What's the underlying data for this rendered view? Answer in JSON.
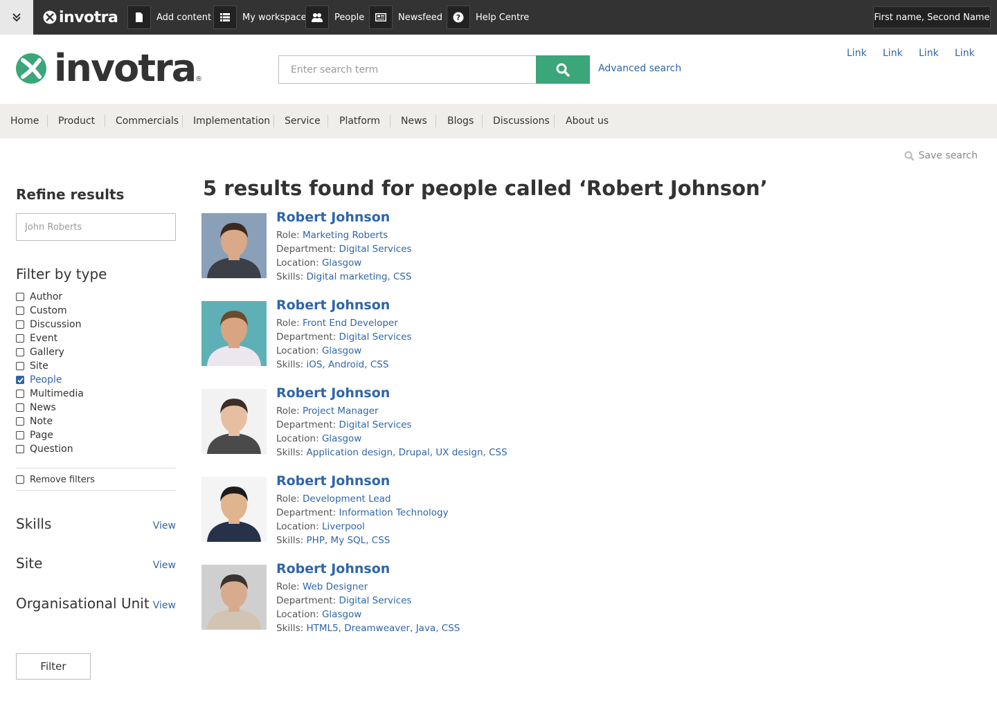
{
  "topbar": {
    "brand": "invotra",
    "items": [
      {
        "label": "Add content",
        "icon": "document-icon"
      },
      {
        "label": "My workspace",
        "icon": "list-icon"
      },
      {
        "label": "People",
        "icon": "people-icon"
      },
      {
        "label": "Newsfeed",
        "icon": "newsfeed-icon"
      },
      {
        "label": "Help Centre",
        "icon": "help-icon"
      }
    ],
    "user": "First name, Second Name"
  },
  "header": {
    "brand": "invotra",
    "search_placeholder": "Enter search term",
    "advanced_search": "Advanced search",
    "links": [
      "Link",
      "Link",
      "Link",
      "Link"
    ]
  },
  "nav": [
    "Home",
    "Product",
    "Commercials",
    "Implementation",
    "Service",
    "Platform",
    "News",
    "Blogs",
    "Discussions",
    "About us"
  ],
  "save_search": "Save search",
  "sidebar": {
    "refine_title": "Refine results",
    "refine_placeholder": "John Roberts",
    "filter_type_title": "Filter by type",
    "types": [
      {
        "label": "Author",
        "checked": false
      },
      {
        "label": "Custom",
        "checked": false
      },
      {
        "label": "Discussion",
        "checked": false
      },
      {
        "label": "Event",
        "checked": false
      },
      {
        "label": "Gallery",
        "checked": false
      },
      {
        "label": "Site",
        "checked": false
      },
      {
        "label": "People",
        "checked": true
      },
      {
        "label": "Multimedia",
        "checked": false
      },
      {
        "label": "News",
        "checked": false
      },
      {
        "label": "Note",
        "checked": false
      },
      {
        "label": "Page",
        "checked": false
      },
      {
        "label": "Question",
        "checked": false
      }
    ],
    "remove_filters": "Remove filters",
    "facets": [
      {
        "title": "Skills",
        "view": "View"
      },
      {
        "title": "Site",
        "view": "View"
      },
      {
        "title": "Organisational Unit",
        "view": "View"
      }
    ],
    "filter_button": "Filter"
  },
  "results": {
    "title": "5 results found for people called ‘Robert Johnson’",
    "labels": {
      "role": "Role:",
      "department": "Department:",
      "location": "Location:",
      "skills": "Skills:"
    },
    "items": [
      {
        "name": "Robert Johnson",
        "role": "Marketing Roberts",
        "department": "Digital Services",
        "location": "Glasgow",
        "skills": "Digital marketing, CSS"
      },
      {
        "name": "Robert Johnson",
        "role": "Front End Developer",
        "department": "Digital Services",
        "location": "Glasgow",
        "skills": "iOS, Android, CSS"
      },
      {
        "name": "Robert Johnson",
        "role": "Project Manager",
        "department": "Digital Services",
        "location": "Glasgow",
        "skills": "Application design, Drupal, UX design, CSS"
      },
      {
        "name": "Robert Johnson",
        "role": "Development Lead",
        "department": "Information Technology",
        "location": "Liverpool",
        "skills": "PHP, My SQL, CSS"
      },
      {
        "name": "Robert Johnson",
        "role": "Web Designer",
        "department": "Digital Services",
        "location": "Glasgow",
        "skills": "HTML5, Dreamweaver, Java, CSS"
      }
    ]
  },
  "colors": {
    "accent": "#3aa67a",
    "link": "#2f65a8",
    "topbar": "#333333",
    "nav_bg": "#efeeea"
  }
}
